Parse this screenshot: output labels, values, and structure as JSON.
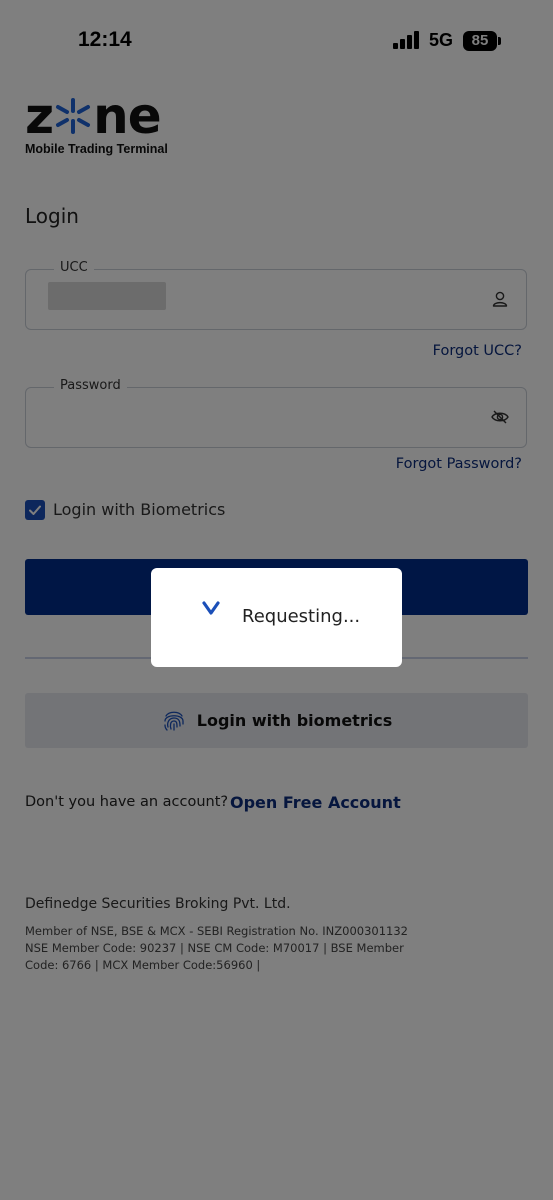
{
  "status_bar": {
    "time": "12:14",
    "network": "5G",
    "battery": "85"
  },
  "logo": {
    "word_start": "z",
    "word_end": "ne",
    "subtitle": "Mobile Trading Terminal"
  },
  "login": {
    "title": "Login",
    "ucc_label": "UCC",
    "forgot_ucc": "Forgot UCC?",
    "password_label": "Password",
    "forgot_password": "Forgot Password?",
    "biometrics_checkbox_label": "Login with Biometrics",
    "biometrics_checked": true,
    "biometrics_button": "Login with biometrics"
  },
  "account": {
    "question": "Don't you have an account?",
    "link": "Open Free Account"
  },
  "footer": {
    "company": "Definedge Securities Broking Pvt. Ltd.",
    "line1": "Member of NSE, BSE & MCX - SEBI Registration No. INZ000301132",
    "line2": "NSE Member Code: 90237 | NSE CM Code: M70017 |  BSE Member",
    "line3": "Code: 6766 | MCX Member Code:56960 |"
  },
  "dialog": {
    "message": "Requesting..."
  },
  "colors": {
    "primary": "#002d8a",
    "link": "#0c2d7c",
    "logo_accent": "#1e63d6",
    "overlay": "rgba(0,0,0,0.5)"
  },
  "icons": [
    "person-icon",
    "eye-off-icon",
    "checkmark-icon",
    "fingerprint-icon",
    "spinner-icon"
  ]
}
